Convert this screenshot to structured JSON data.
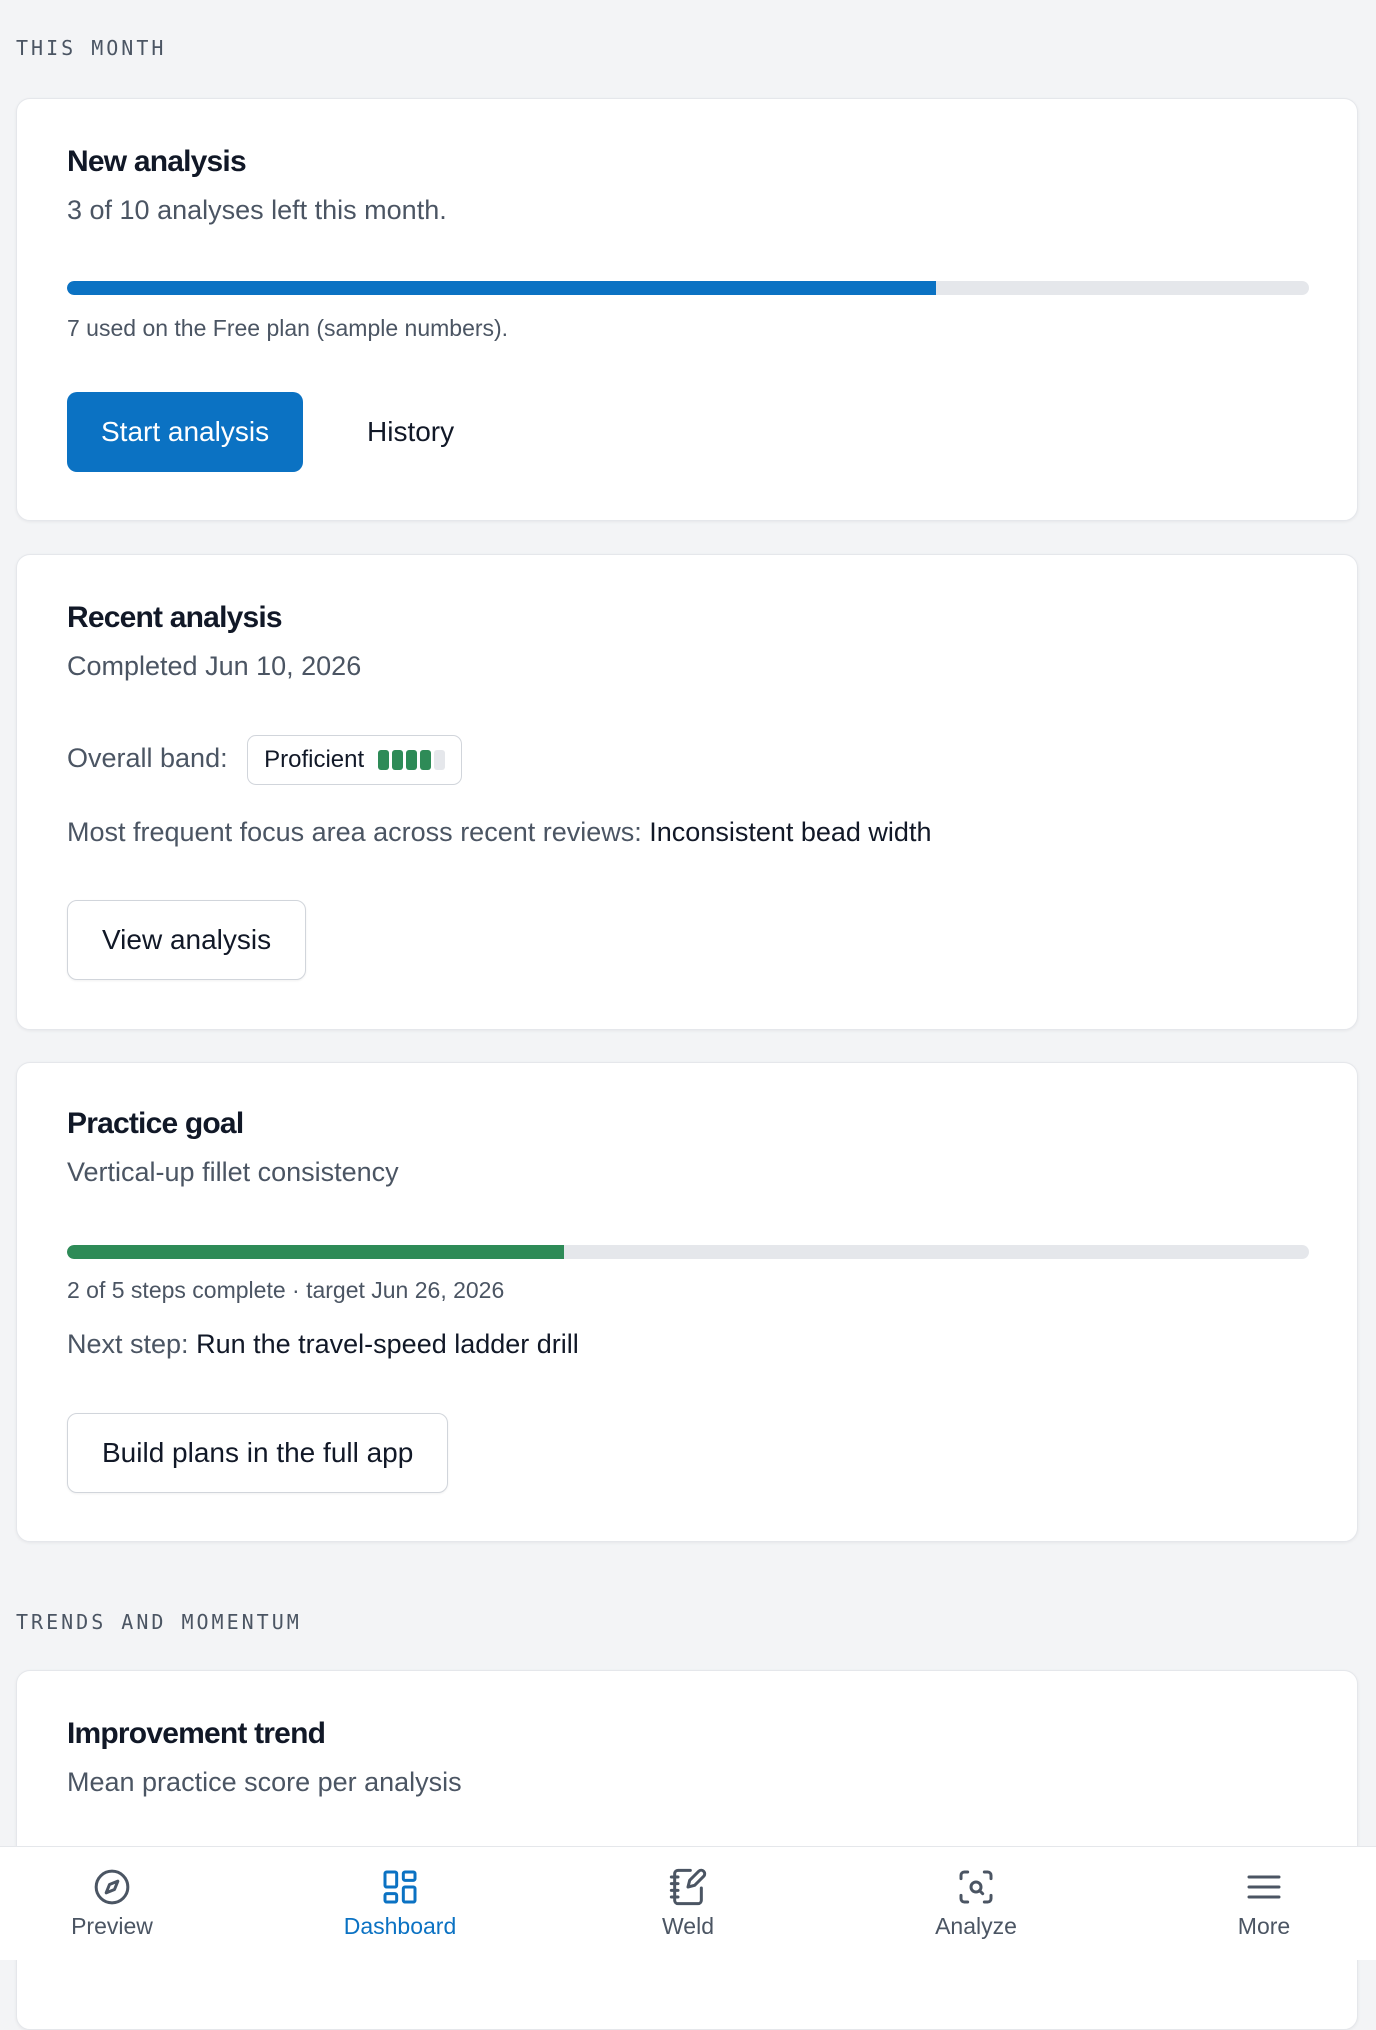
{
  "sections": {
    "this_month": "THIS MONTH",
    "trends": "TRENDS AND MOMENTUM"
  },
  "new_analysis": {
    "title": "New analysis",
    "subtitle": "3 of 10 analyses left this month.",
    "progress_used_fraction": 0.7,
    "usage_note": "7 used on the Free plan (sample numbers).",
    "start_label": "Start analysis",
    "history_label": "History"
  },
  "recent_analysis": {
    "title": "Recent analysis",
    "subtitle": "Completed Jun 10, 2026",
    "band_label": "Overall band:",
    "band_value": "Proficient",
    "band_level": 4,
    "band_max": 5,
    "focus_label": "Most frequent focus area across recent reviews:",
    "focus_value": "Inconsistent bead width",
    "view_label": "View analysis"
  },
  "practice_goal": {
    "title": "Practice goal",
    "subtitle": "Vertical-up fillet consistency",
    "progress_fraction": 0.4,
    "progress_note": "2 of 5 steps complete · target Jun 26, 2026",
    "next_label": "Next step:",
    "next_value": "Run the travel-speed ladder drill",
    "build_label": "Build plans in the full app"
  },
  "improvement_trend": {
    "title": "Improvement trend",
    "subtitle": "Mean practice score per analysis"
  },
  "nav": {
    "items": [
      {
        "label": "Preview",
        "icon": "compass-icon"
      },
      {
        "label": "Dashboard",
        "icon": "grid-icon"
      },
      {
        "label": "Weld",
        "icon": "notebook-pen-icon"
      },
      {
        "label": "Analyze",
        "icon": "scan-search-icon"
      },
      {
        "label": "More",
        "icon": "menu-icon"
      }
    ],
    "active_index": 1
  },
  "colors": {
    "primary": "#0b72c3",
    "success": "#2e8b57",
    "track": "#e5e7eb",
    "background": "#f3f4f6"
  }
}
